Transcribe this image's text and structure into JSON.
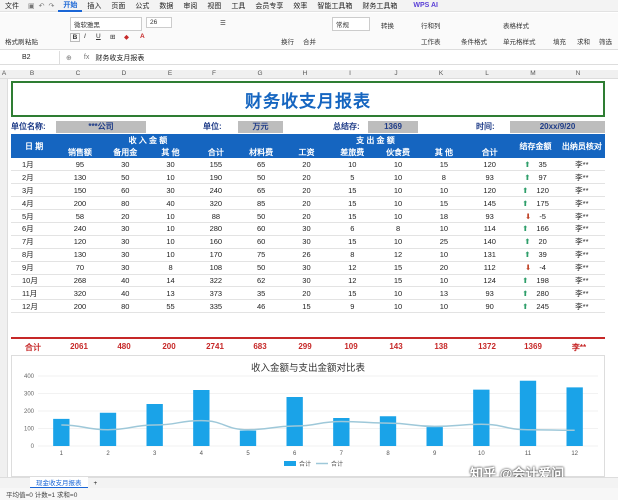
{
  "menubar": {
    "file": "文件",
    "tabs": [
      "开始",
      "插入",
      "页面",
      "公式",
      "数据",
      "审阅",
      "视图",
      "工具",
      "会员专享",
      "效率",
      "智能工具箱",
      "财务工具箱"
    ],
    "active_tab": "开始",
    "ai": "WPS AI"
  },
  "toolbar": {
    "format_painter": "格式刷",
    "paste": "粘贴",
    "font_name": "微软雅黑",
    "font_size": "26",
    "align_auto": "换行",
    "merge": "合并",
    "number_format": "常规",
    "convert": "转换",
    "rows_cols": "行和列",
    "worksheet": "工作表",
    "cond_format": "条件格式",
    "table_style": "表格样式",
    "cell_style": "单元格样式",
    "fill": "填充",
    "sum": "求和",
    "filter": "筛选"
  },
  "formula_bar": {
    "cell_ref": "B2",
    "content": "财务收支月报表"
  },
  "columns": [
    "A",
    "B",
    "C",
    "D",
    "E",
    "F",
    "G",
    "H",
    "I",
    "J",
    "K",
    "L",
    "M",
    "N"
  ],
  "report": {
    "title": "财务收支月报表",
    "unit_label": "单位名称:",
    "unit_value": "***公司",
    "currency_label": "单位:",
    "currency_value": "万元",
    "balance_label": "总结存:",
    "balance_value": "1369",
    "time_label": "时间:",
    "time_value": "20xx/9/20",
    "header_date": "日 期",
    "header_income": "收 入 金 额",
    "header_expense": "支 出 金 额",
    "header_balance": "结存金额",
    "header_checker": "出纳员核对",
    "sub_headers": [
      "销售额",
      "备用金",
      "其 他",
      "合计",
      "材料费",
      "工资",
      "差旅费",
      "伙食费",
      "其 他",
      "合计"
    ],
    "rows": [
      [
        "1月",
        "95",
        "30",
        "30",
        "155",
        "65",
        "20",
        "10",
        "10",
        "15",
        "120",
        "up",
        "35",
        "李**"
      ],
      [
        "2月",
        "130",
        "50",
        "10",
        "190",
        "50",
        "20",
        "5",
        "10",
        "8",
        "93",
        "up",
        "97",
        "李**"
      ],
      [
        "3月",
        "150",
        "60",
        "30",
        "240",
        "65",
        "20",
        "15",
        "10",
        "10",
        "120",
        "up",
        "120",
        "李**"
      ],
      [
        "4月",
        "200",
        "80",
        "40",
        "320",
        "85",
        "20",
        "15",
        "10",
        "15",
        "145",
        "up",
        "175",
        "李**"
      ],
      [
        "5月",
        "58",
        "20",
        "10",
        "88",
        "50",
        "20",
        "15",
        "10",
        "18",
        "93",
        "down",
        "-5",
        "李**"
      ],
      [
        "6月",
        "240",
        "30",
        "10",
        "280",
        "60",
        "30",
        "6",
        "8",
        "10",
        "114",
        "up",
        "166",
        "李**"
      ],
      [
        "7月",
        "120",
        "30",
        "10",
        "160",
        "60",
        "30",
        "15",
        "10",
        "25",
        "140",
        "up",
        "20",
        "李**"
      ],
      [
        "8月",
        "130",
        "30",
        "10",
        "170",
        "75",
        "26",
        "8",
        "12",
        "10",
        "131",
        "up",
        "39",
        "李**"
      ],
      [
        "9月",
        "70",
        "30",
        "8",
        "108",
        "50",
        "30",
        "12",
        "15",
        "20",
        "112",
        "down",
        "-4",
        "李**"
      ],
      [
        "10月",
        "268",
        "40",
        "14",
        "322",
        "62",
        "30",
        "12",
        "15",
        "10",
        "124",
        "up",
        "198",
        "李**"
      ],
      [
        "11月",
        "320",
        "40",
        "13",
        "373",
        "35",
        "20",
        "15",
        "10",
        "13",
        "93",
        "up",
        "280",
        "李**"
      ],
      [
        "12月",
        "200",
        "80",
        "55",
        "335",
        "46",
        "15",
        "9",
        "10",
        "10",
        "90",
        "up",
        "245",
        "李**"
      ]
    ],
    "total": [
      "合计",
      "2061",
      "480",
      "200",
      "2741",
      "683",
      "299",
      "109",
      "143",
      "138",
      "1372",
      "1369",
      "李**"
    ]
  },
  "chart_data": {
    "type": "bar",
    "title": "收入金额与支出金额对比表",
    "categories": [
      "1",
      "2",
      "3",
      "4",
      "5",
      "6",
      "7",
      "8",
      "9",
      "10",
      "11",
      "12"
    ],
    "series": [
      {
        "name": "合计",
        "type": "bar",
        "values": [
          155,
          190,
          240,
          320,
          88,
          280,
          160,
          170,
          108,
          322,
          373,
          335
        ]
      },
      {
        "name": "合计",
        "type": "line",
        "values": [
          120,
          93,
          120,
          145,
          93,
          114,
          140,
          131,
          112,
          124,
          93,
          90
        ]
      }
    ],
    "ylim": [
      0,
      400
    ],
    "yticks": [
      "0",
      "100",
      "200",
      "300",
      "400"
    ],
    "colors": {
      "bar": "#1aa3e8",
      "line": "#9ec8d9"
    },
    "legend_position": "bottom",
    "grid": true
  },
  "sheet_tabs": {
    "active": "现金收支月报表",
    "add": "+"
  },
  "statusbar": {
    "text": "平均值=0  计数=1  求和=0"
  },
  "watermark": "知乎 @会计爱问"
}
